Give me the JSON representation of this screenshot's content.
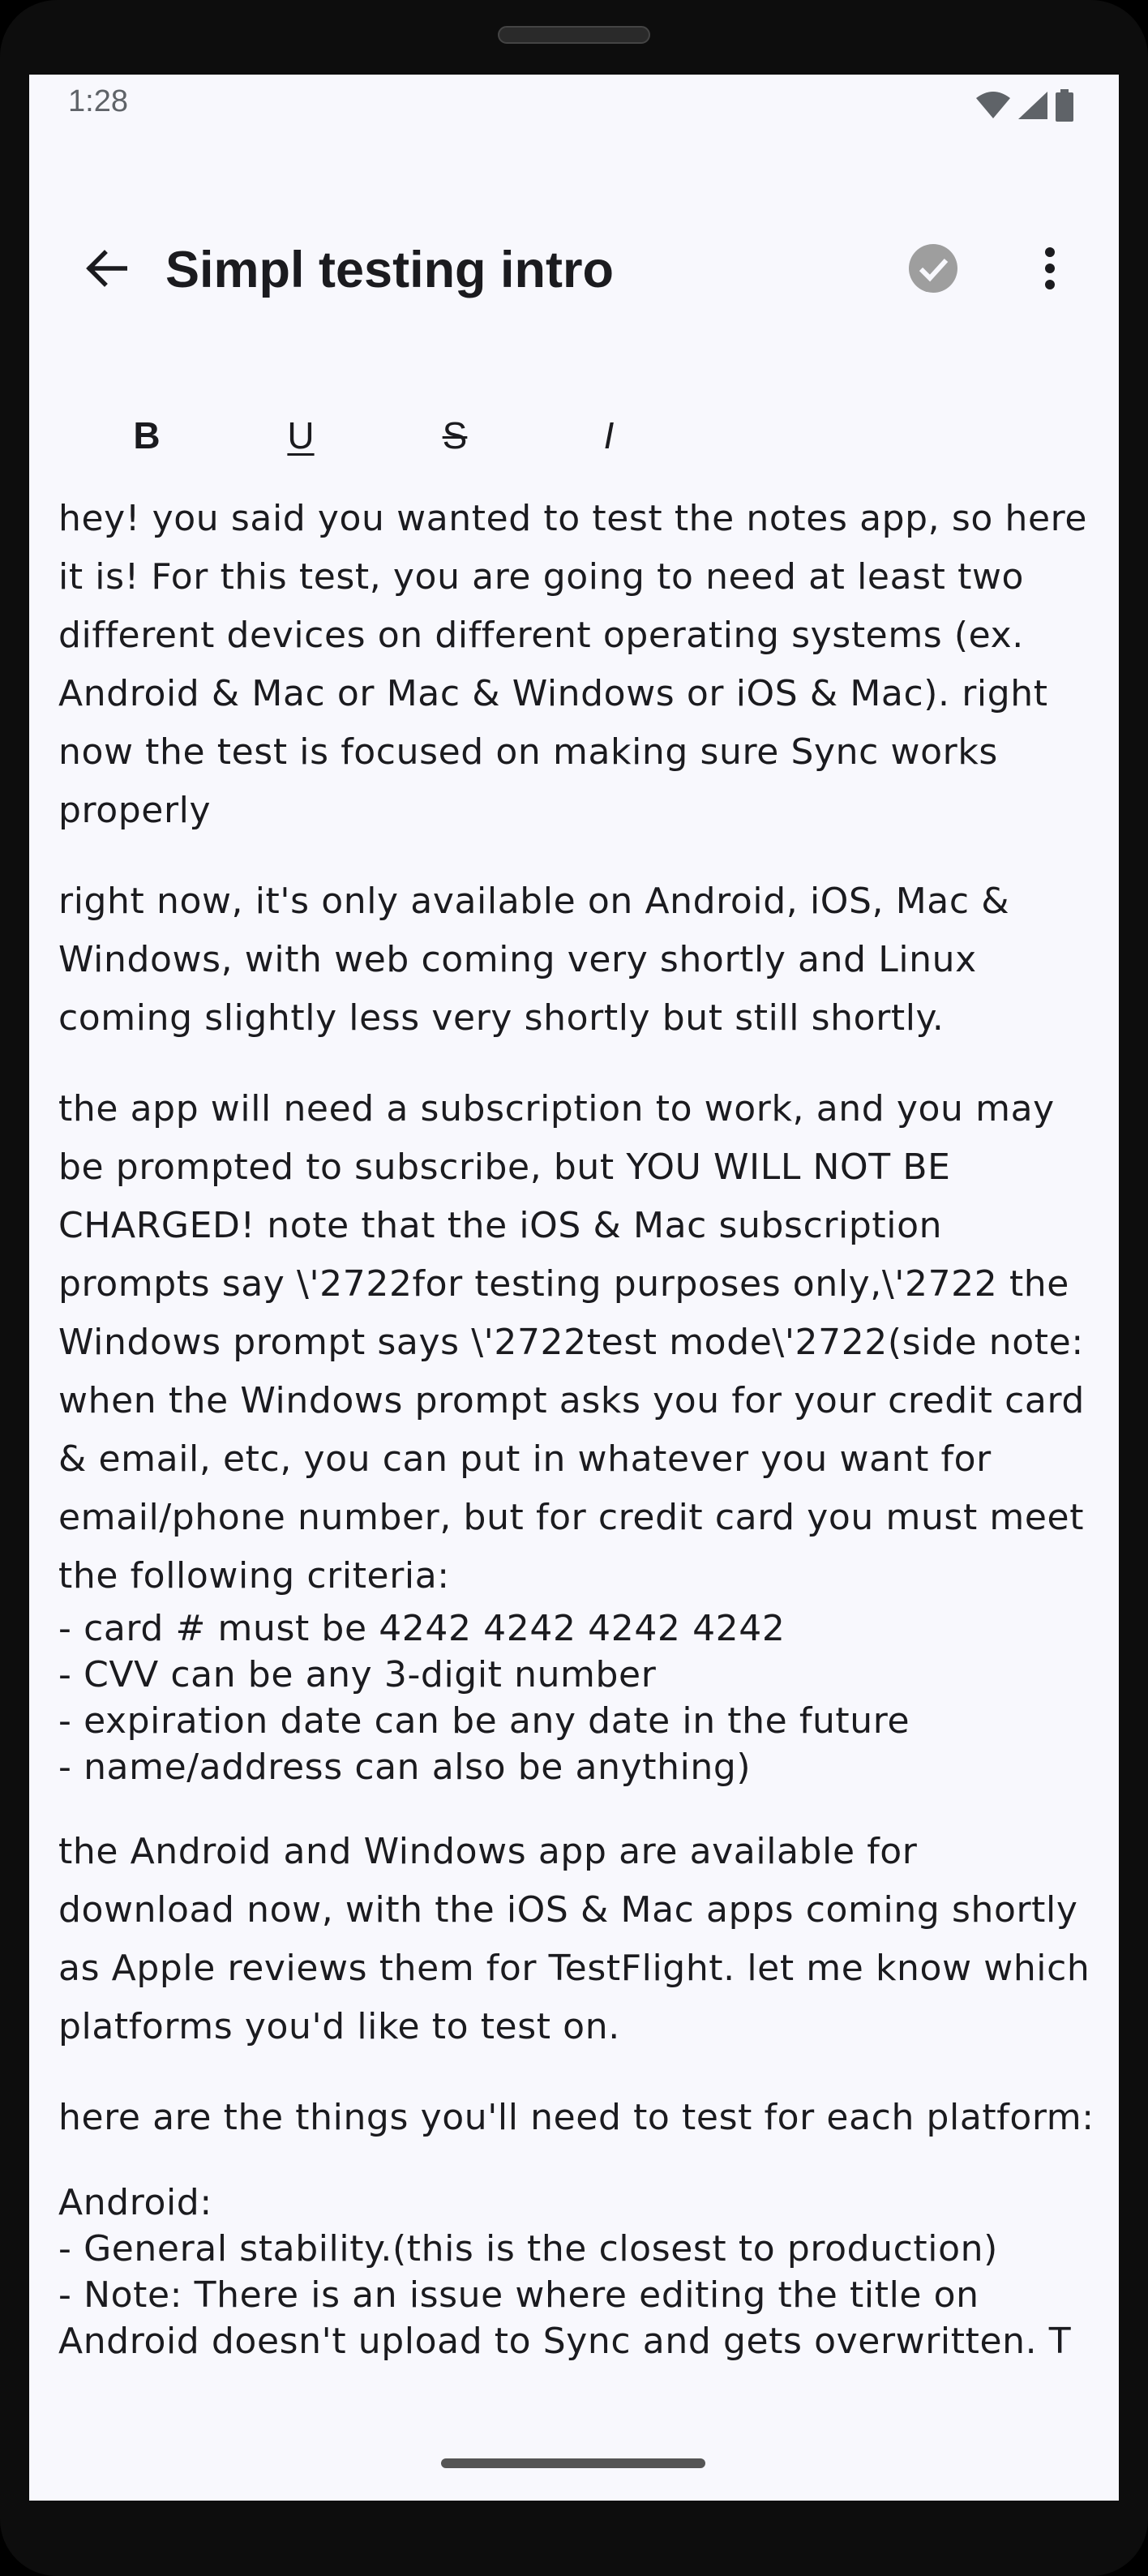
{
  "status_bar": {
    "time": "1:28",
    "icons": [
      "wifi-icon",
      "signal-icon",
      "battery-icon"
    ]
  },
  "app_bar": {
    "title": "Simpl testing intro",
    "back_icon": "arrow-back-icon",
    "done_icon": "check-circle-icon",
    "menu_icon": "more-vert-icon"
  },
  "format_toolbar": {
    "bold": "B",
    "underline": "U",
    "strikethrough": "S",
    "italic": "I"
  },
  "note": {
    "p1": "hey! you said you wanted to test the notes app, so here it is! For this test, you are going to need at least two different devices on different operating systems (ex. Android & Mac or Mac & Windows or iOS & Mac). right now the test is focused on making sure Sync works properly",
    "p2": "right now, it's only available on Android, iOS, Mac & Windows, with web coming very shortly and Linux coming slightly less very shortly but still shortly.",
    "p3": "the app will need a subscription to work, and you may be prompted to subscribe, but YOU WILL NOT BE CHARGED! note that the iOS & Mac subscription prompts say \\'2722for testing purposes only,\\'2722 the Windows prompt says \\'2722test mode\\'2722(side note: when the Windows prompt asks you for your credit card & email, etc, you can put in whatever you want for email/phone number, but for credit card you must meet the following criteria:",
    "criteria": [
      "- card # must be 4242 4242 4242 4242",
      "- CVV can be any 3-digit number",
      "- expiration date can be any date in the future",
      "- name/address can also be anything)"
    ],
    "p4": "the Android and Windows app are available for download now, with the iOS & Mac apps coming shortly as Apple reviews them for TestFlight. let me know which platforms you'd like to test on.",
    "p5": "here are the things you'll need to test for each platform:",
    "android_heading": "Android:",
    "android_items": [
      "- General stability.(this is the closest to production)",
      "- Note: There is an issue where editing the title on",
      "Android doesn't upload to Sync and gets overwritten. T"
    ]
  },
  "colors": {
    "screen_bg": "#f8f8fd",
    "text": "#1b1b1f",
    "icon_muted": "#9e9e9e"
  }
}
